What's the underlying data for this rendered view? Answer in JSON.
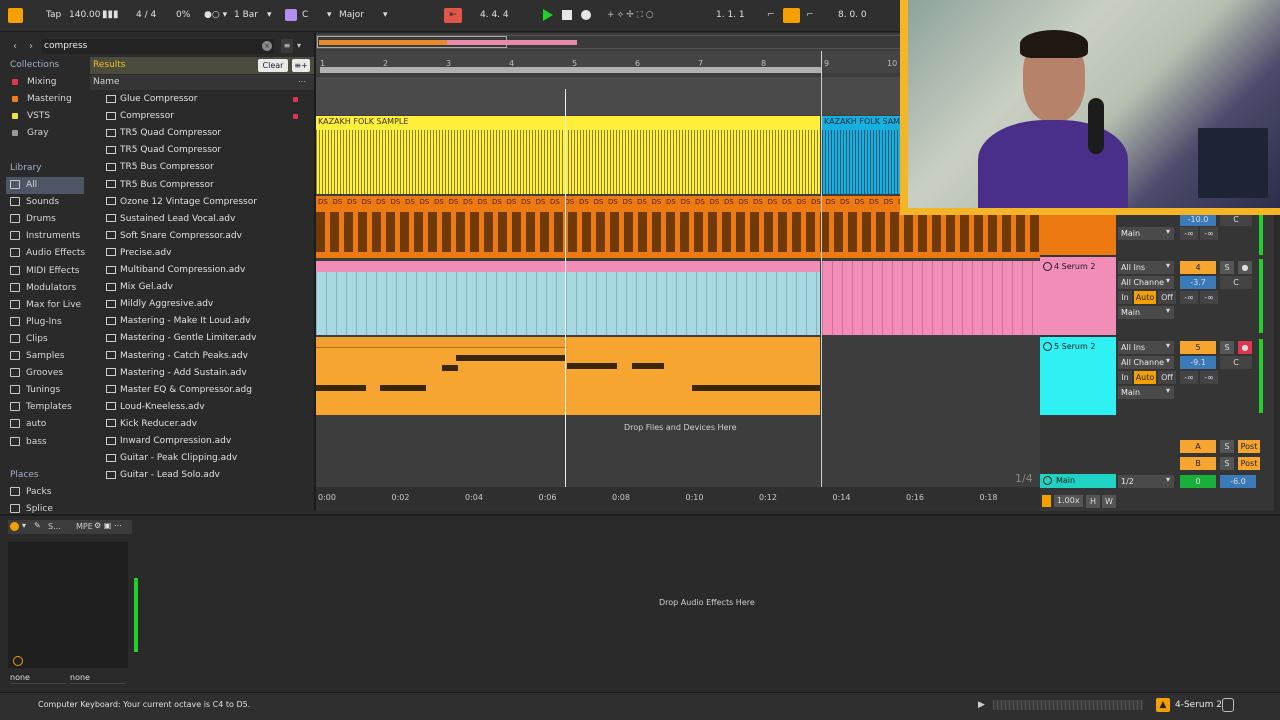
{
  "colors": {
    "bg": "#2b2b2b",
    "panel": "#242424",
    "yellow": "#ffee3a",
    "blue": "#16b0e0",
    "orange": "#ed7a10",
    "pink": "#f28db8",
    "lightblue": "#a8d8e2",
    "amber": "#f5a530",
    "cyan": "#2ff0f2",
    "accent": "#f5a000",
    "green": "#22d02a"
  },
  "transport": {
    "tap_label": "Tap",
    "tempo": "140.00",
    "meter": "4 / 4",
    "swing": "0%",
    "quantize": "1 Bar",
    "key": "C",
    "scale": "Major",
    "position": "4.   4.   4",
    "loop_start": "1.   1.   1",
    "loop_length": "8.   0.   0"
  },
  "browser": {
    "search_value": "compress",
    "collections_header": "Collections",
    "collections": [
      {
        "label": "Mixing",
        "color": "#e0344c"
      },
      {
        "label": "Mastering",
        "color": "#f07a20"
      },
      {
        "label": "VSTS",
        "color": "#f2e23a"
      },
      {
        "label": "Gray",
        "color": "#9a9a9a"
      }
    ],
    "library_header": "Library",
    "library": [
      "All",
      "Sounds",
      "Drums",
      "Instruments",
      "Audio Effects",
      "MIDI Effects",
      "Modulators",
      "Max for Live",
      "Plug-Ins",
      "Clips",
      "Samples",
      "Grooves",
      "Tunings",
      "Templates",
      "auto",
      "bass"
    ],
    "places_header": "Places",
    "places": [
      "Packs",
      "Splice"
    ],
    "results_label": "Results",
    "clear_label": "Clear",
    "name_header": "Name",
    "results": [
      {
        "name": "Glue Compressor",
        "flag": true
      },
      {
        "name": "Compressor",
        "flag": true
      },
      {
        "name": "TR5 Quad Compressor",
        "flag": false
      },
      {
        "name": "TR5 Quad Compressor",
        "flag": false
      },
      {
        "name": "TR5 Bus Compressor",
        "flag": false
      },
      {
        "name": "TR5 Bus Compressor",
        "flag": false
      },
      {
        "name": "Ozone 12 Vintage Compressor",
        "flag": false
      },
      {
        "name": "Sustained Lead Vocal.adv",
        "flag": false
      },
      {
        "name": "Soft Snare Compressor.adv",
        "flag": false
      },
      {
        "name": "Precise.adv",
        "flag": false
      },
      {
        "name": "Multiband Compression.adv",
        "flag": false
      },
      {
        "name": "Mix Gel.adv",
        "flag": false
      },
      {
        "name": "Mildly Aggresive.adv",
        "flag": false
      },
      {
        "name": "Mastering - Make It Loud.adv",
        "flag": false
      },
      {
        "name": "Mastering - Gentle Limiter.adv",
        "flag": false
      },
      {
        "name": "Mastering - Catch Peaks.adv",
        "flag": false
      },
      {
        "name": "Mastering - Add Sustain.adv",
        "flag": false
      },
      {
        "name": "Master EQ & Compressor.adg",
        "flag": false
      },
      {
        "name": "Loud-Kneeless.adv",
        "flag": false
      },
      {
        "name": "Kick Reducer.adv",
        "flag": false
      },
      {
        "name": "Inward Compression.adv",
        "flag": false
      },
      {
        "name": "Guitar - Peak Clipping.adv",
        "flag": false
      },
      {
        "name": "Guitar - Lead Solo.adv",
        "flag": false
      }
    ]
  },
  "arrangement": {
    "bar_numbers": [
      "1",
      "2",
      "3",
      "4",
      "5",
      "6",
      "7",
      "8",
      "9",
      "10"
    ],
    "time_labels": [
      "0:00",
      "0:02",
      "0:04",
      "0:06",
      "0:08",
      "0:10",
      "0:12",
      "0:14",
      "0:16",
      "0:18"
    ],
    "clip1_label": "KAZAKH FOLK SAMPLE",
    "clip2_label": "KAZAKH FOLK SAMPL",
    "drum_label": "DS",
    "drop_files": "Drop Files and Devices Here",
    "zoom_fraction": "1/4",
    "zoom_value": "1.00x",
    "h_label": "H",
    "w_label": "W"
  },
  "mixer": {
    "tracks": [
      {
        "name": "",
        "input": "",
        "channel": "",
        "output": "Main",
        "num": "",
        "vol": "-10.0",
        "pan": "C"
      },
      {
        "name": "4 Serum 2",
        "input": "All Ins",
        "channel": "All Channe",
        "output": "Main",
        "num": "4",
        "vol": "-3.7",
        "pan": "C"
      },
      {
        "name": "5 Serum 2",
        "input": "All Ins",
        "channel": "All Channe",
        "output": "Main",
        "num": "5",
        "vol": "-9.1",
        "pan": "C"
      }
    ],
    "monitor": {
      "in": "In",
      "auto": "Auto",
      "off": "Off"
    },
    "neg_inf": "-∞",
    "solo": "S",
    "returns": [
      {
        "name": "A Reverb",
        "letter": "A",
        "post": "Post",
        "color": "#9fd1f0"
      },
      {
        "name": "B Delay",
        "letter": "B",
        "post": "Post",
        "color": "#c77ad9"
      }
    ],
    "main": {
      "name": "Main",
      "out": "1/2",
      "num": "0",
      "vol": "-6.0"
    }
  },
  "device": {
    "title_short": "S...",
    "mpe_label": "MPE",
    "drop_audio": "Drop Audio Effects Here",
    "io_left": "none",
    "io_right": "none"
  },
  "status": {
    "message": "Computer Keyboard: Your current octave is C4 to D5.",
    "track_name": "4-Serum 2"
  }
}
